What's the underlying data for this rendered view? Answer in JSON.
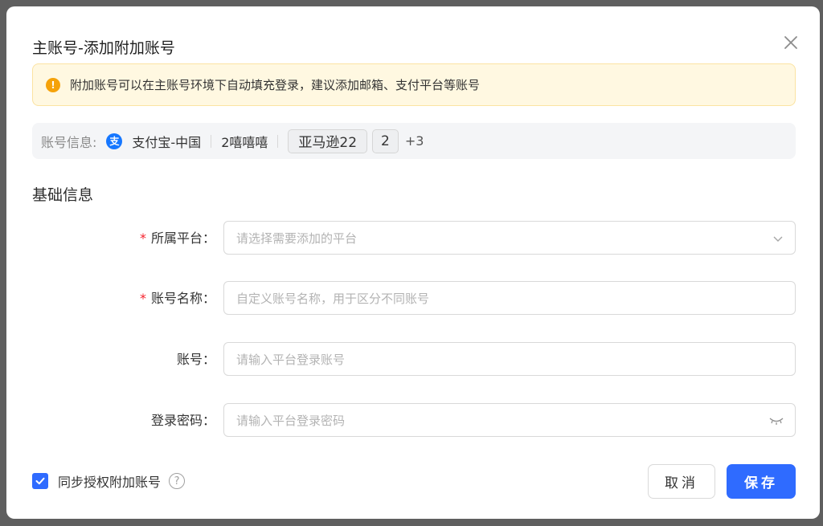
{
  "dialog": {
    "title": "主账号-添加附加账号"
  },
  "alert": {
    "text": "附加账号可以在主账号环境下自动填充登录，建议添加邮箱、支付平台等账号",
    "color": "#f5a20a"
  },
  "account_info": {
    "label": "账号信息:",
    "platform": "支付宝-中国",
    "name": "2嘻嘻嘻",
    "chips": [
      "亚马逊22",
      "2"
    ],
    "more": "+3"
  },
  "section": {
    "title": "基础信息"
  },
  "form": {
    "platform": {
      "label": "所属平台：",
      "required": "*",
      "placeholder": "请选择需要添加的平台"
    },
    "account_name": {
      "label": "账号名称：",
      "required": "*",
      "placeholder": "自定义账号名称，用于区分不同账号"
    },
    "account": {
      "label": "账号：",
      "placeholder": "请输入平台登录账号"
    },
    "password": {
      "label": "登录密码：",
      "placeholder": "请输入平台登录密码"
    }
  },
  "footer": {
    "sync_label": "同步授权附加账号",
    "cancel_label": "取消",
    "save_label": "保存",
    "accent_color": "#2f6bff"
  }
}
